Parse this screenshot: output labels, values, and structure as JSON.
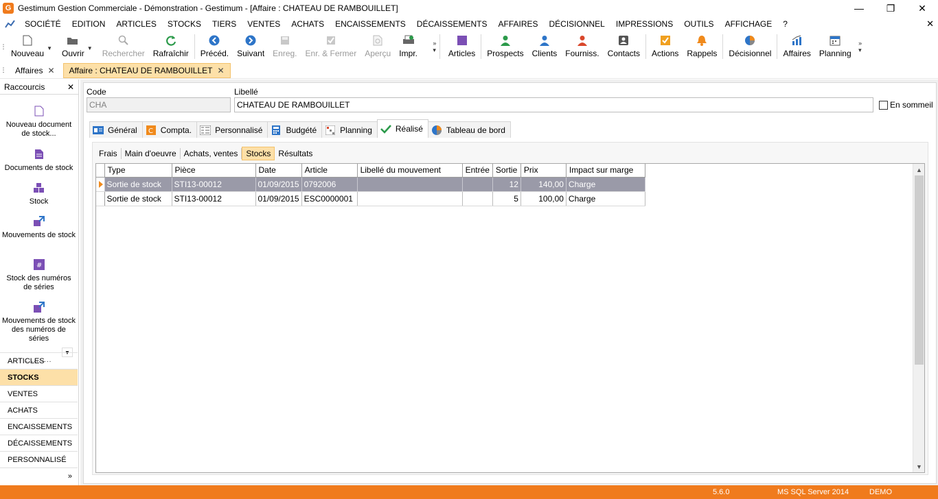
{
  "window": {
    "logo_letter": "G",
    "title": "Gestimum Gestion Commerciale - Démonstration - Gestimum - [Affaire : CHATEAU DE RAMBOUILLET]",
    "minimize": "—",
    "restore": "❐",
    "close": "✕"
  },
  "menu": {
    "items": [
      "SOCIÉTÉ",
      "EDITION",
      "ARTICLES",
      "STOCKS",
      "TIERS",
      "VENTES",
      "ACHATS",
      "ENCAISSEMENTS",
      "DÉCAISSEMENTS",
      "AFFAIRES",
      "DÉCISIONNEL",
      "IMPRESSIONS",
      "OUTILS",
      "AFFICHAGE",
      "?"
    ],
    "close_glyph": "✕"
  },
  "toolbar": {
    "nouveau": "Nouveau",
    "ouvrir": "Ouvrir",
    "rechercher": "Rechercher",
    "rafraichir": "Rafraîchir",
    "preced": "Précéd.",
    "suivant": "Suivant",
    "enreg": "Enreg.",
    "enr_fermer": "Enr. & Fermer",
    "apercu": "Aperçu",
    "impr": "Impr.",
    "articles": "Articles",
    "prospects": "Prospects",
    "clients": "Clients",
    "fourniss": "Fourniss.",
    "contacts": "Contacts",
    "actions": "Actions",
    "rappels": "Rappels",
    "decisionnel": "Décisionnel",
    "affaires": "Affaires",
    "planning": "Planning"
  },
  "doc_tabs": [
    {
      "label": "Affaires",
      "close": "✕"
    },
    {
      "label": "Affaire : CHATEAU DE RAMBOUILLET",
      "close": "✕"
    }
  ],
  "sidebar": {
    "title": "Raccourcis",
    "close": "✕",
    "shortcuts": [
      "Nouveau document de stock...",
      "Documents de stock",
      "Stock",
      "Mouvements de stock",
      "Stock des numéros de séries",
      "Mouvements de stock des numéros de séries"
    ],
    "dots": "..........",
    "sections": [
      "ARTICLES",
      "STOCKS",
      "VENTES",
      "ACHATS",
      "ENCAISSEMENTS",
      "DÉCAISSEMENTS",
      "PERSONNALISÉ"
    ],
    "more": "»"
  },
  "form": {
    "code_label": "Code",
    "code_value": "CHA",
    "libelle_label": "Libellé",
    "libelle_value": "CHATEAU DE RAMBOUILLET",
    "sommeil_label": "En sommeil"
  },
  "form_tabs": [
    "Général",
    "Compta.",
    "Personnalisé",
    "Budgété",
    "Planning",
    "Réalisé",
    "Tableau de bord"
  ],
  "sub_tabs": [
    "Frais",
    "Main d'oeuvre",
    "Achats, ventes",
    "Stocks",
    "Résultats"
  ],
  "grid": {
    "columns": [
      "Type",
      "Pièce",
      "Date",
      "Article",
      "Libellé du mouvement",
      "Entrée",
      "Sortie",
      "Prix",
      "Impact sur marge"
    ],
    "rows": [
      [
        "Sortie de stock",
        "STI13-00012",
        "01/09/2015",
        "0792006",
        "",
        "",
        "12",
        "140,00",
        "Charge"
      ],
      [
        "Sortie de stock",
        "STI13-00012",
        "01/09/2015",
        "ESC0000001",
        "",
        "",
        "5",
        "100,00",
        "Charge"
      ]
    ]
  },
  "status": {
    "version": "5.6.0",
    "server": "MS SQL Server 2014",
    "db": "DEMO"
  },
  "colors": {
    "accent": "#f07b1d",
    "selection_tab": "#fde0a8",
    "selected_row": "#9a9aa8"
  }
}
